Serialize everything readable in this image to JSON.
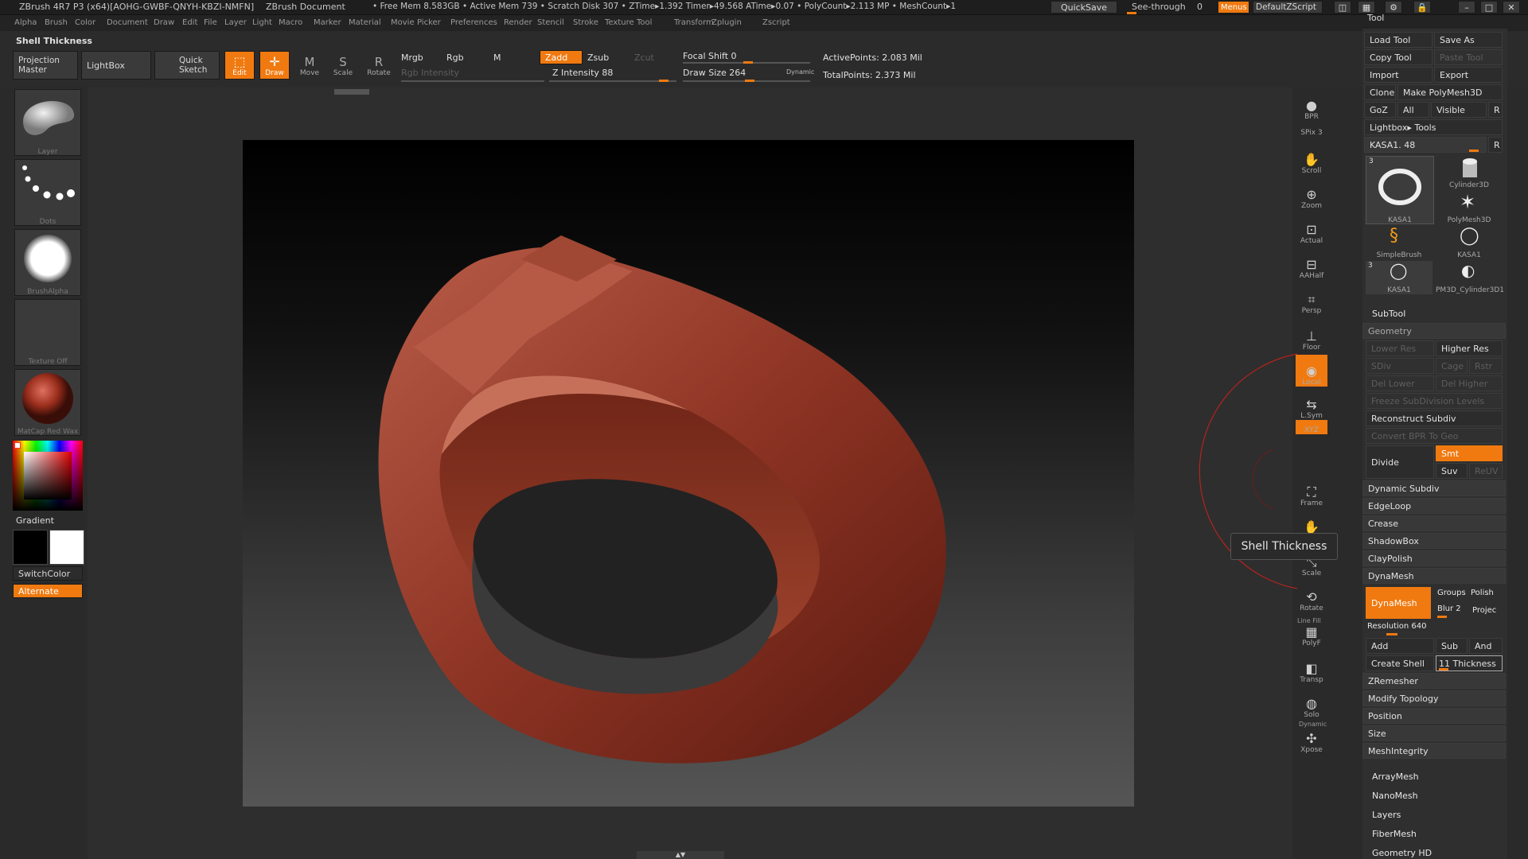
{
  "titlebar": {
    "app": "ZBrush 4R7 P3 (x64)[AOHG-GWBF-QNYH-KBZI-NMFN]",
    "doc": "ZBrush Document",
    "stats": "• Free Mem 8.583GB • Active Mem 739 • Scratch Disk 307 • ZTime▸1.392 Timer▸49.568 ATime▸0.07 • PolyCount▸2.113 MP • MeshCount▸1",
    "quicksave": "QuickSave",
    "see_through": "See-through",
    "see_through_value": "0",
    "menus": "Menus",
    "script": "DefaultZScript"
  },
  "menubar": [
    "Alpha",
    "Brush",
    "Color",
    "Document",
    "Draw",
    "Edit",
    "File",
    "Layer",
    "Light",
    "Macro",
    "Marker",
    "Material",
    "Movie",
    "Picker",
    "Preferences",
    "Render",
    "Stencil",
    "Stroke",
    "Texture",
    "Tool",
    "Transform",
    "Zplugin",
    "Zscript"
  ],
  "toolbar": {
    "status": "Shell Thickness",
    "projection_master": "Projection Master",
    "lightbox": "LightBox",
    "quick_sketch": "Quick Sketch",
    "edit": "Edit",
    "draw": "Draw",
    "move": "Move",
    "scale": "Scale",
    "rotate": "Rotate",
    "mrgb": "Mrgb",
    "rgb": "Rgb",
    "m": "M",
    "rgb_intensity": "Rgb Intensity",
    "zadd": "Zadd",
    "zsub": "Zsub",
    "zcut": "Zcut",
    "z_intensity": "Z Intensity 88",
    "focal_shift": "Focal Shift 0",
    "draw_size": "Draw Size 264",
    "dynamic": "Dynamic",
    "active_points": "ActivePoints: 2.083 Mil",
    "total_points": "TotalPoints: 2.373 Mil"
  },
  "leftshelf": {
    "brush": "Layer",
    "stroke": "Dots",
    "alpha": "BrushAlpha",
    "texture": "Texture Off",
    "material": "MatCap Red Wax",
    "gradient": "Gradient",
    "switchcolor": "SwitchColor",
    "alternate": "Alternate"
  },
  "rightshelf": [
    {
      "label": "BPR",
      "icon": "bpr-icon"
    },
    {
      "label": "SPix 3",
      "icon": "spix-icon"
    },
    {
      "label": "Scroll",
      "icon": "scroll-icon"
    },
    {
      "label": "Zoom",
      "icon": "zoom-icon"
    },
    {
      "label": "Actual",
      "icon": "actual-icon"
    },
    {
      "label": "AAHalf",
      "icon": "aahalf-icon"
    },
    {
      "label": "Persp",
      "icon": "persp-icon"
    },
    {
      "label": "Floor",
      "icon": "floor-icon"
    },
    {
      "label": "Local",
      "icon": "local-icon"
    },
    {
      "label": "L.Sym",
      "icon": "lsym-icon"
    },
    {
      "label": "XYZ",
      "icon": "xyz-icon"
    },
    {
      "label": "Frame",
      "icon": "frame-icon"
    },
    {
      "label": "Move",
      "icon": "move-icon"
    },
    {
      "label": "Scale",
      "icon": "scale-icon"
    },
    {
      "label": "Rotate",
      "icon": "rotate-icon"
    },
    {
      "label": "PolyF",
      "icon": "polyf-icon"
    },
    {
      "label": "Transp",
      "icon": "transp-icon"
    },
    {
      "label": "Solo",
      "icon": "solo-icon"
    },
    {
      "label": "Xpose",
      "icon": "xpose-icon"
    }
  ],
  "rightshelf_extra": {
    "line_fill": "Line Fill",
    "dynamic": "Dynamic"
  },
  "tooltip": "Shell Thickness",
  "tool_panel": {
    "header": "Tool",
    "load_tool": "Load Tool",
    "save_as": "Save As",
    "copy_tool": "Copy Tool",
    "paste_tool": "Paste Tool",
    "import": "Import",
    "export": "Export",
    "clone": "Clone",
    "make_polymesh": "Make PolyMesh3D",
    "goz": "GoZ",
    "all": "All",
    "visible": "Visible",
    "r": "R",
    "lightbox_tools": "Lightbox▸ Tools",
    "kasa_slider": "KASA1. 48",
    "tools": [
      {
        "label": "KASA1",
        "count": "3"
      },
      {
        "label": "Cylinder3D",
        "count": ""
      },
      {
        "label": "PolyMesh3D",
        "count": ""
      },
      {
        "label": "SimpleBrush",
        "count": ""
      },
      {
        "label": "KASA1",
        "count": ""
      },
      {
        "label": "KASA1",
        "count": "3"
      },
      {
        "label": "PM3D_Cylinder3D1",
        "count": ""
      }
    ],
    "subtool": "SubTool",
    "geometry": "Geometry",
    "lower_res": "Lower Res",
    "higher_res": "Higher Res",
    "sdiv": "SDiv",
    "cage": "Cage",
    "rstr": "Rstr",
    "del_lower": "Del Lower",
    "del_higher": "Del Higher",
    "freeze": "Freeze SubDivision Levels",
    "reconstruct": "Reconstruct Subdiv",
    "convert_bpr": "Convert BPR To Geo",
    "divide": "Divide",
    "smt": "Smt",
    "suv": "Suv",
    "reuv": "ReUV",
    "dynamic_subdiv": "Dynamic Subdiv",
    "edgeloop": "EdgeLoop",
    "crease": "Crease",
    "shadowbox": "ShadowBox",
    "claypolish": "ClayPolish",
    "dynamesh_head": "DynaMesh",
    "dynamesh_btn": "DynaMesh",
    "groups": "Groups",
    "polish": "Polish",
    "blur": "Blur 2",
    "project": "Projec",
    "resolution": "Resolution 640",
    "add": "Add",
    "sub": "Sub",
    "and": "And",
    "create_shell": "Create Shell",
    "thickness": "11 Thickness",
    "zremesher": "ZRemesher",
    "modify_topology": "Modify Topology",
    "position": "Position",
    "size": "Size",
    "meshintegrity": "MeshIntegrity",
    "arraymesh": "ArrayMesh",
    "nanomesh": "NanoMesh",
    "layers": "Layers",
    "fibermesh": "FiberMesh",
    "geometry_hd": "Geometry HD"
  }
}
